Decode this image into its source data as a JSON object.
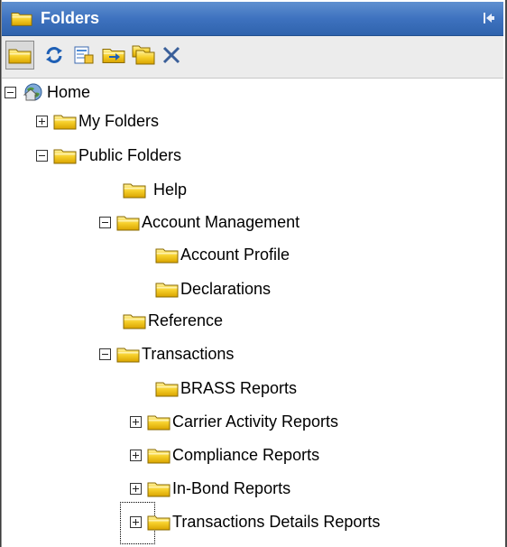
{
  "panel": {
    "title": "Folders"
  },
  "toolbar": {
    "buttons": [
      {
        "name": "folder-icon"
      },
      {
        "name": "refresh-icon"
      },
      {
        "name": "properties-icon"
      },
      {
        "name": "move-folder-icon"
      },
      {
        "name": "copy-folder-icon"
      },
      {
        "name": "delete-icon"
      }
    ]
  },
  "tree": {
    "home": "Home",
    "my_folders": "My Folders",
    "public_folders": "Public Folders",
    "help": "Help",
    "account_management": "Account Management",
    "account_profile": "Account Profile",
    "declarations": "Declarations",
    "reference": "Reference",
    "transactions": "Transactions",
    "brass_reports": "BRASS Reports",
    "carrier_activity_reports": "Carrier Activity Reports",
    "compliance_reports": "Compliance Reports",
    "in_bond_reports": "In-Bond Reports",
    "transactions_details_reports": "Transactions Details Reports"
  },
  "colors": {
    "title_bar": "#3e72bf",
    "folder_yellow": "#f2c51c"
  }
}
